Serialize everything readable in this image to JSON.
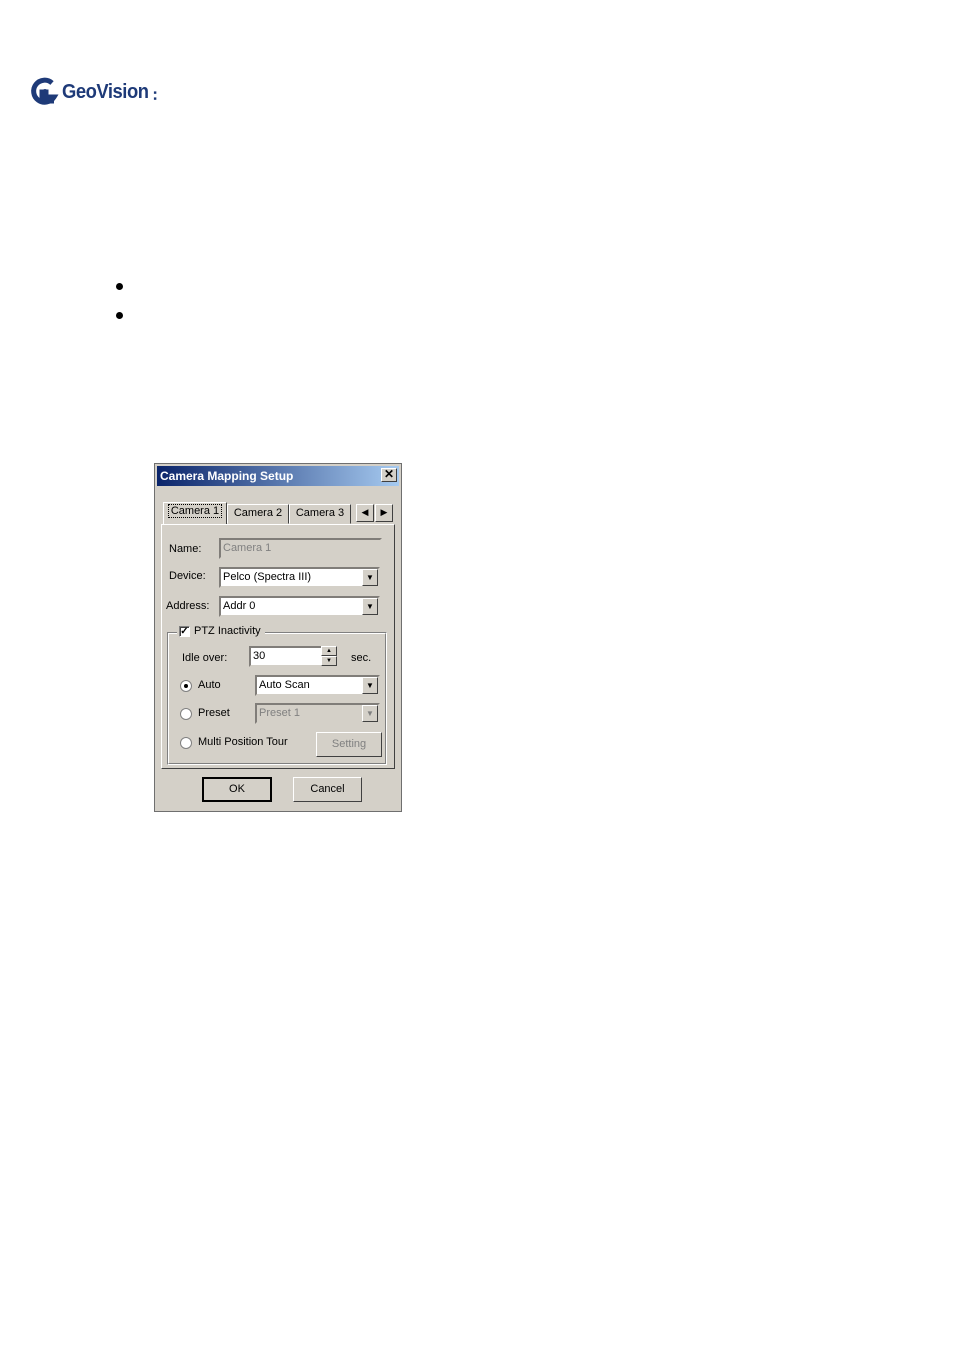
{
  "logo": {
    "brand_text": "GeoVision",
    "colors": {
      "brand": "#1e3a78"
    }
  },
  "dialog": {
    "title": "Camera Mapping Setup",
    "close_glyph": "✕",
    "tabs": [
      {
        "label": "Camera 1",
        "active": true
      },
      {
        "label": "Camera 2",
        "active": false
      },
      {
        "label": "Camera 3",
        "active": false
      }
    ],
    "tab_scroll": {
      "left": "◀",
      "right": "▶"
    },
    "name": {
      "label": "Name:",
      "value": "Camera 1"
    },
    "device": {
      "label": "Device:",
      "value": "Pelco (Spectra III)"
    },
    "address": {
      "label": "Address:",
      "value": "Addr 0"
    },
    "ptz": {
      "label": "PTZ Inactivity",
      "checked": true,
      "check_glyph": "✓",
      "idle_label": "Idle over:",
      "idle_value": "30",
      "idle_unit": "sec.",
      "auto": {
        "label": "Auto",
        "selected": true,
        "value": "Auto Scan"
      },
      "preset": {
        "label": "Preset",
        "selected": false,
        "value": "Preset 1"
      },
      "tour": {
        "label": "Multi Position Tour",
        "selected": false,
        "button": "Setting"
      }
    },
    "buttons": {
      "ok": "OK",
      "cancel": "Cancel"
    },
    "colors": {
      "title_start": "#0a246a",
      "title_end": "#a6caf0",
      "face": "#d4d0c8"
    }
  }
}
